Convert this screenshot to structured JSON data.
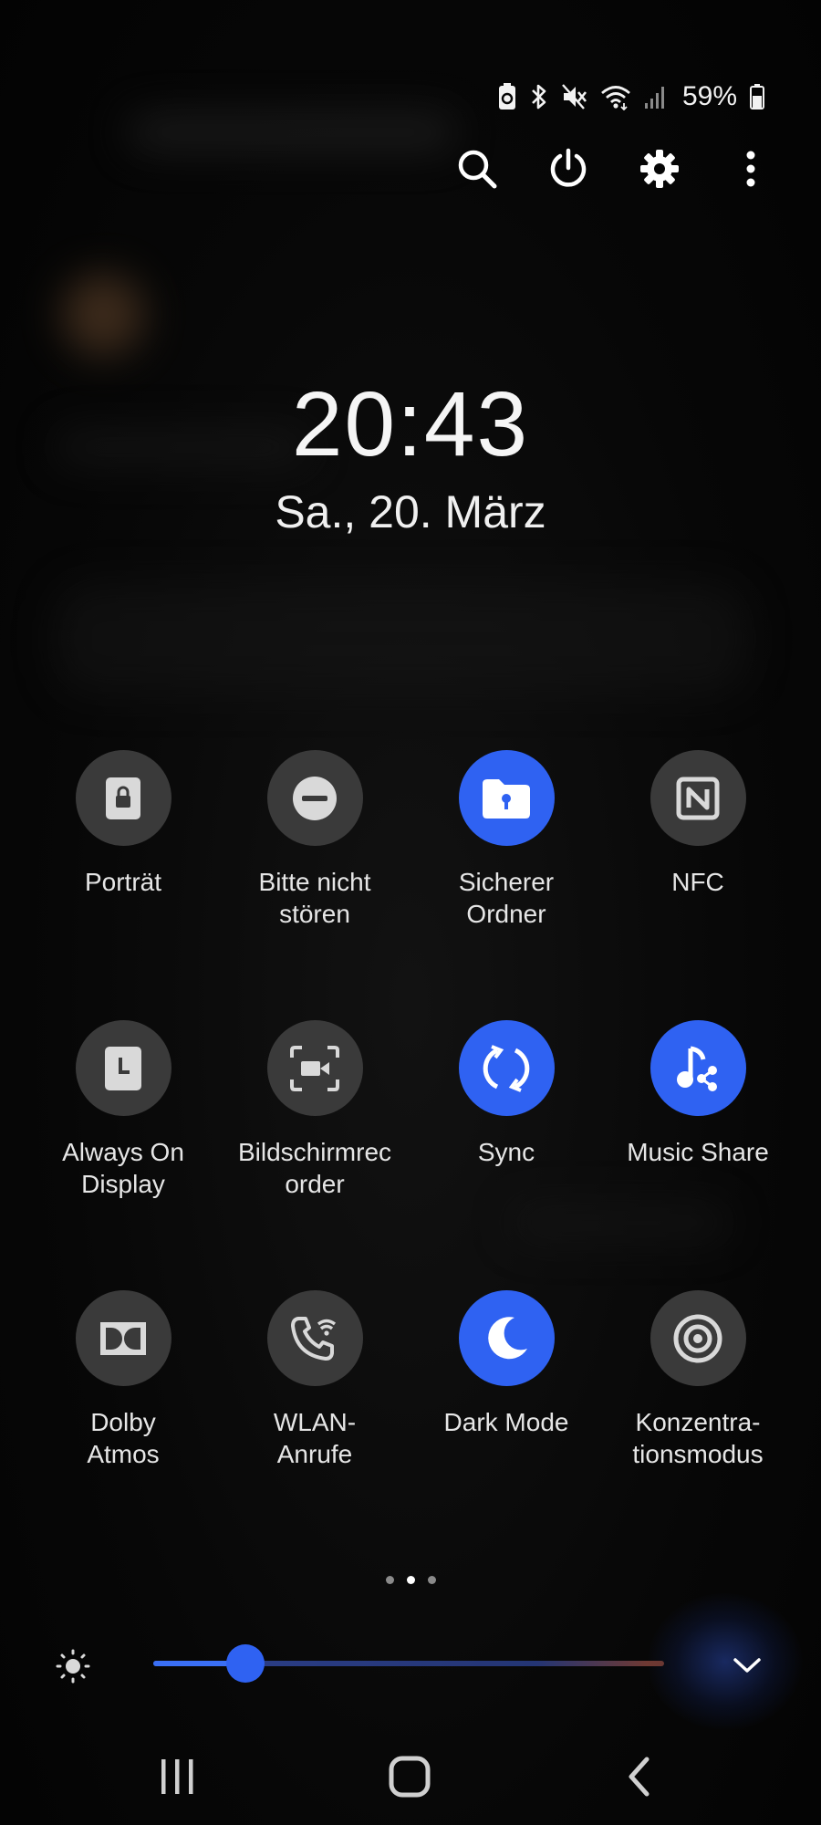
{
  "status_bar": {
    "battery_percent_text": "59%",
    "battery_level": 0.59,
    "icons": [
      "battery-saver-icon",
      "bluetooth-icon",
      "mute-icon",
      "wifi-icon",
      "signal-icon",
      "battery-icon"
    ]
  },
  "top_actions": [
    "search-icon",
    "power-icon",
    "settings-gear-icon",
    "more-vertical-icon"
  ],
  "clock": {
    "time": "20:43",
    "date": "Sa., 20. März"
  },
  "tiles": [
    {
      "label": "Porträt",
      "icon": "portrait-lock-icon",
      "active": false
    },
    {
      "label": "Bitte nicht\nstören",
      "icon": "do-not-disturb-icon",
      "active": false
    },
    {
      "label": "Sicherer\nOrdner",
      "icon": "secure-folder-icon",
      "active": true
    },
    {
      "label": "NFC",
      "icon": "nfc-icon",
      "active": false
    },
    {
      "label": "Always On\nDisplay",
      "icon": "always-on-display-icon",
      "active": false
    },
    {
      "label": "Bildschirmrec\norder",
      "icon": "screen-recorder-icon",
      "active": false
    },
    {
      "label": "Sync",
      "icon": "sync-icon",
      "active": true
    },
    {
      "label": "Music Share",
      "icon": "music-share-icon",
      "active": true
    },
    {
      "label": "Dolby\nAtmos",
      "icon": "dolby-atmos-icon",
      "active": false
    },
    {
      "label": "WLAN-\nAnrufe",
      "icon": "wifi-calling-icon",
      "active": false
    },
    {
      "label": "Dark Mode",
      "icon": "dark-mode-moon-icon",
      "active": true
    },
    {
      "label": "Konzentra-\ntionsmodus",
      "icon": "focus-mode-icon",
      "active": false
    }
  ],
  "pager": {
    "pages": 3,
    "current": 1
  },
  "brightness": {
    "level": 0.18
  },
  "colors": {
    "accent": "#2f62f2",
    "tile_inactive": "#3a3a3a",
    "background": "#050505"
  },
  "navbar": [
    "recents-icon",
    "home-icon",
    "back-icon"
  ]
}
